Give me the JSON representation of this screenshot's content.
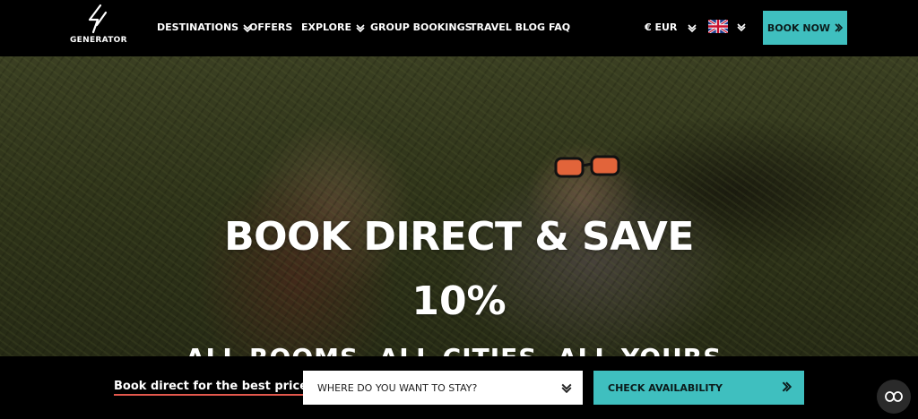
{
  "logo": {
    "text": "GENERATOR",
    "icon": "generator-bolt-logo"
  },
  "nav": {
    "items": [
      {
        "label": "DESTINATIONS",
        "has_dropdown": true
      },
      {
        "label": "OFFERS",
        "has_dropdown": false
      },
      {
        "label": "EXPLORE",
        "has_dropdown": true
      },
      {
        "label": "GROUP BOOKINGS",
        "has_dropdown": false
      },
      {
        "label": "TRAVEL BLOG",
        "has_dropdown": false
      },
      {
        "label": "FAQ",
        "has_dropdown": false
      }
    ],
    "currency": "€ EUR",
    "language_flag": "uk-flag-icon",
    "book_now": "BOOK NOW"
  },
  "hero": {
    "title": "BOOK DIRECT & SAVE",
    "percent": "10%",
    "subtitle": "ALL ROOMS. ALL CITIES. ALL YOURS."
  },
  "booking": {
    "label": "Book direct for the best prices",
    "destination_placeholder": "WHERE DO YOU WANT TO STAY?",
    "check_button": "CHECK AVAILABILITY"
  },
  "colors": {
    "accent": "#3fbfbf",
    "underline": "#e2574c",
    "background": "#000000"
  }
}
